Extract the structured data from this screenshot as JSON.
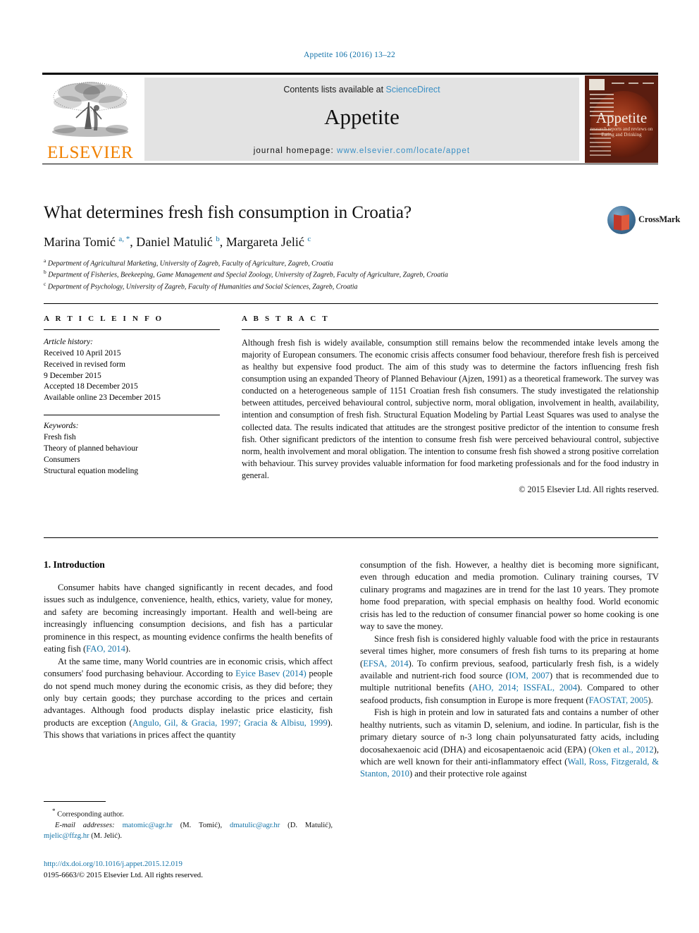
{
  "running_head": "Appetite 106 (2016) 13–22",
  "masthead": {
    "contents_prefix": "Contents lists available at ",
    "contents_link": "ScienceDirect",
    "journal_wordmark": "Appetite",
    "homepage_label": "journal homepage: ",
    "homepage_url": "www.elsevier.com/locate/appet",
    "publisher_logo_text": "ELSEVIER",
    "cover": {
      "title": "Appetite",
      "subtitle_line1": "research reports and reviews on",
      "subtitle_line2": "Eating and Drinking"
    }
  },
  "article": {
    "title": "What determines fresh fish consumption in Croatia?",
    "authors_html": "Marina Tomić <sup>a, *</sup>, Daniel Matulić <sup>b</sup>, Margareta Jelić <sup>c</sup>",
    "affiliations": [
      "Department of Agricultural Marketing, University of Zagreb, Faculty of Agriculture, Zagreb, Croatia",
      "Department of Fisheries, Beekeeping, Game Management and Special Zoology, University of Zagreb, Faculty of Agriculture, Zagreb, Croatia",
      "Department of Psychology, University of Zagreb, Faculty of Humanities and Social Sciences, Zagreb, Croatia"
    ],
    "affiliation_marks": [
      "a",
      "b",
      "c"
    ],
    "crossmark_label": "CrossMark"
  },
  "article_info": {
    "heading": "A R T I C L E  I N F O",
    "history_label": "Article history:",
    "history": [
      "Received 10 April 2015",
      "Received in revised form",
      "9 December 2015",
      "Accepted 18 December 2015",
      "Available online 23 December 2015"
    ],
    "keywords_label": "Keywords:",
    "keywords": [
      "Fresh fish",
      "Theory of planned behaviour",
      "Consumers",
      "Structural equation modeling"
    ]
  },
  "abstract": {
    "heading": "A B S T R A C T",
    "text": "Although fresh fish is widely available, consumption still remains below the recommended intake levels among the majority of European consumers. The economic crisis affects consumer food behaviour, therefore fresh fish is perceived as healthy but expensive food product. The aim of this study was to determine the factors influencing fresh fish consumption using an expanded Theory of Planned Behaviour (Ajzen, 1991) as a theoretical framework. The survey was conducted on a heterogeneous sample of 1151 Croatian fresh fish consumers. The study investigated the relationship between attitudes, perceived behavioural control, subjective norm, moral obligation, involvement in health, availability, intention and consumption of fresh fish. Structural Equation Modeling by Partial Least Squares was used to analyse the collected data. The results indicated that attitudes are the strongest positive predictor of the intention to consume fresh fish. Other significant predictors of the intention to consume fresh fish were perceived behavioural control, subjective norm, health involvement and moral obligation. The intention to consume fresh fish showed a strong positive correlation with behaviour. This survey provides valuable information for food marketing professionals and for the food industry in general.",
    "copyright": "© 2015 Elsevier Ltd. All rights reserved."
  },
  "body": {
    "section_heading": "1. Introduction",
    "left_paragraphs": [
      "Consumer habits have changed significantly in recent decades, and food issues such as indulgence, convenience, health, ethics, variety, value for money, and safety are becoming increasingly important. Health and well-being are increasingly influencing consumption decisions, and fish has a particular prominence in this respect, as mounting evidence confirms the health benefits of eating fish (FAO, 2014).",
      "At the same time, many World countries are in economic crisis, which affect consumers' food purchasing behaviour. According to Eyice Basev (2014) people do not spend much money during the economic crisis, as they did before; they only buy certain goods; they purchase according to the prices and certain advantages. Although food products display inelastic price elasticity, fish products are exception (Angulo, Gil, & Gracia, 1997; Gracia & Albisu, 1999). This shows that variations in prices affect the quantity"
    ],
    "right_paragraphs": [
      "consumption of the fish. However, a healthy diet is becoming more significant, even through education and media promotion. Culinary training courses, TV culinary programs and magazines are in trend for the last 10 years. They promote home food preparation, with special emphasis on healthy food. World economic crisis has led to the reduction of consumer financial power so home cooking is one way to save the money.",
      "Since fresh fish is considered highly valuable food with the price in restaurants several times higher, more consumers of fresh fish turns to its preparing at home (EFSA, 2014). To confirm previous, seafood, particularly fresh fish, is a widely available and nutrient-rich food source (IOM, 2007) that is recommended due to multiple nutritional benefits (AHO, 2014; ISSFAL, 2004). Compared to other seafood products, fish consumption in Europe is more frequent (FAOSTAT, 2005).",
      "Fish is high in protein and low in saturated fats and contains a number of other healthy nutrients, such as vitamin D, selenium, and iodine. In particular, fish is the primary dietary source of n-3 long chain polyunsaturated fatty acids, including docosahexaenoic acid (DHA) and eicosapentaenoic acid (EPA) (Oken et al., 2012), which are well known for their anti-inflammatory effect (Wall, Ross, Fitzgerald, & Stanton, 2010) and their protective role against"
    ],
    "references_inline": [
      "FAO, 2014",
      "Eyice Basev (2014)",
      "Angulo, Gil, & Gracia, 1997; Gracia & Albisu, 1999",
      "EFSA, 2014",
      "IOM, 2007",
      "AHO, 2014; ISSFAL, 2004",
      "FAOSTAT, 2005",
      "Oken et al., 2012",
      "Wall, Ross, Fitzgerald, & Stanton, 2010"
    ]
  },
  "footnote": {
    "corresponding_mark": "*",
    "corresponding_label": "Corresponding author.",
    "email_label": "E-mail addresses:",
    "emails": [
      {
        "address": "matomic@agr.hr",
        "person": "(M. Tomić)"
      },
      {
        "address": "dmatulic@agr.hr",
        "person": "(D. Matulić)"
      },
      {
        "address": "mjelic@ffzg.hr",
        "person": "(M. Jelić)"
      }
    ]
  },
  "imprint": {
    "doi": "http://dx.doi.org/10.1016/j.appet.2015.12.019",
    "issn_line": "0195-6663/© 2015 Elsevier Ltd. All rights reserved."
  },
  "colors": {
    "link_blue": "#1574a8",
    "masthead_link_blue": "#3a8fc4",
    "elsevier_orange": "#f08000",
    "masthead_grey": "#e3e3e3",
    "cover_brown": "#5a1d10"
  }
}
